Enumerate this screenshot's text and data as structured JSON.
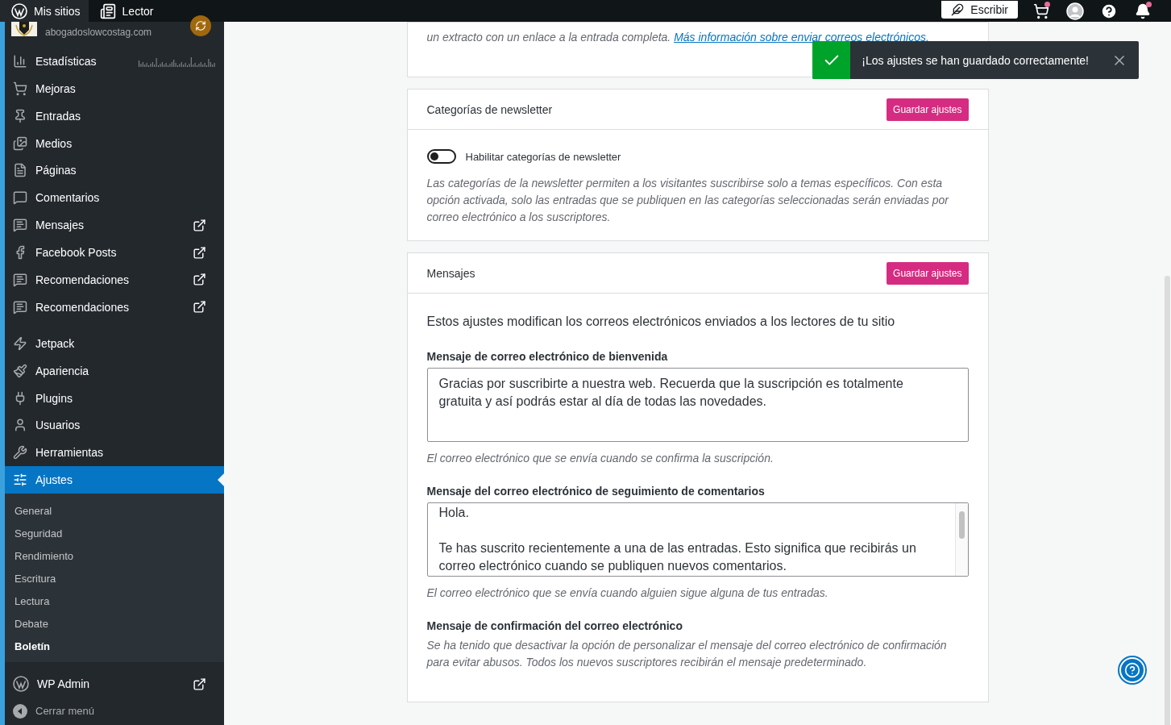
{
  "topbar": {
    "left": [
      {
        "kind": "wp",
        "label": "Mis sitios",
        "selected": true
      },
      {
        "kind": "reader",
        "label": "Lector",
        "selected": false
      }
    ],
    "write_button": "Escribir"
  },
  "site": {
    "url": "abogadoslowcostag.com"
  },
  "sidebar": {
    "sections": [
      {
        "items": [
          {
            "label": "Estadísticas",
            "external": false,
            "selected": false
          },
          {
            "label": "Mejoras",
            "external": false,
            "selected": false
          },
          {
            "label": "Entradas",
            "external": false,
            "selected": false
          },
          {
            "label": "Medios",
            "external": false,
            "selected": false
          },
          {
            "label": "Páginas",
            "external": false,
            "selected": false
          },
          {
            "label": "Comentarios",
            "external": false,
            "selected": false
          },
          {
            "label": "Mensajes",
            "external": true,
            "selected": false
          },
          {
            "label": "Facebook Posts",
            "external": true,
            "selected": false
          },
          {
            "label": "Recomendaciones",
            "external": true,
            "selected": false
          },
          {
            "label": "Recomendaciones",
            "external": true,
            "selected": false
          }
        ]
      },
      {
        "items": [
          {
            "label": "Jetpack",
            "external": false,
            "selected": false
          },
          {
            "label": "Apariencia",
            "external": false,
            "selected": false
          },
          {
            "label": "Plugins",
            "external": false,
            "selected": false
          },
          {
            "label": "Usuarios",
            "external": false,
            "selected": false
          },
          {
            "label": "Herramientas",
            "external": false,
            "selected": false
          },
          {
            "label": "Ajustes",
            "external": false,
            "selected": true
          }
        ]
      }
    ],
    "submenu": [
      {
        "label": "General",
        "selected": false
      },
      {
        "label": "Seguridad",
        "selected": false
      },
      {
        "label": "Rendimiento",
        "selected": false
      },
      {
        "label": "Escritura",
        "selected": false
      },
      {
        "label": "Lectura",
        "selected": false
      },
      {
        "label": "Debate",
        "selected": false
      },
      {
        "label": "Boletín",
        "selected": true
      }
    ],
    "wp_admin": "WP Admin",
    "collapse": "Cerrar menú"
  },
  "top_card": {
    "text": "un extracto con un enlace a la entrada completa.",
    "link": "Más información sobre enviar correos electrónicos",
    "after_link": "."
  },
  "notice": {
    "message": "¡Los ajustes se han guardado correctamente!"
  },
  "categories_card": {
    "title": "Categorías de newsletter",
    "save": "Guardar ajustes",
    "toggle": {
      "label": "Habilitar categorías de newsletter",
      "on": false
    },
    "description": "Las categorías de la newsletter permiten a los visitantes suscribirse solo a temas específicos. Con esta opción activada, solo las entradas que se publiquen en las categorías seleccionadas serán enviadas por correo electrónico a los suscriptores."
  },
  "messages_card": {
    "title": "Mensajes",
    "save": "Guardar ajustes",
    "intro": "Estos ajustes modifican los correos electrónicos enviados a los lectores de tu sitio",
    "welcome": {
      "label": "Mensaje de correo electrónico de bienvenida",
      "value": [
        "Gracias por suscribirte a nuestra web. Recuerda que la suscripción es totalmente gratuita y así podrás estar al día de todas las novedades."
      ],
      "help": "El correo electrónico que se envía cuando se confirma la suscripción."
    },
    "follow": {
      "label": "Mensaje del correo electrónico de seguimiento de comentarios",
      "value": [
        "Hola.",
        "Te has suscrito recientemente a una de las entradas. Esto significa que recibirás un correo electrónico cuando se publiquen nuevos comentarios."
      ],
      "help": "El correo electrónico que se envía cuando alguien sigue alguna de tus entradas."
    },
    "confirm": {
      "label": "Mensaje de confirmación del correo electrónico",
      "help": "Se ha tenido que desactivar la opción de personalizar el mensaje del correo electrónico de confirmación para evitar abusos. Todos los nuevos suscriptores recibirán el mensaje predeterminado."
    }
  }
}
